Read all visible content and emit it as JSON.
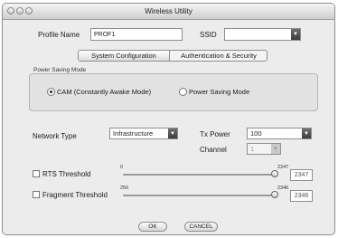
{
  "window": {
    "title": "Wireless Utility"
  },
  "profile": {
    "label": "Profile Name",
    "value": "PROF1"
  },
  "ssid": {
    "label": "SSID",
    "value": ""
  },
  "tabs": [
    {
      "label": "System Configuration",
      "active": true
    },
    {
      "label": "Authentication & Security",
      "active": false
    }
  ],
  "power_saving": {
    "group_label": "Power Saving Mode",
    "options": [
      {
        "label": "CAM (Constantly Awake Mode)",
        "selected": true
      },
      {
        "label": "Power Saving Mode",
        "selected": false
      }
    ]
  },
  "network_type": {
    "label": "Network Type",
    "value": "Infrastructure"
  },
  "tx_power": {
    "label": "Tx Power",
    "value": "100"
  },
  "channel": {
    "label": "Channel",
    "value": "1"
  },
  "rts": {
    "label": "RTS Threshold",
    "checked": false,
    "min": "0",
    "max": "2347",
    "value": "2347",
    "level": 1.0
  },
  "fragment": {
    "label": "Fragment Threshold",
    "checked": false,
    "min": "256",
    "max": "2346",
    "value": "2346",
    "level": 1.0
  },
  "buttons": {
    "ok": "OK",
    "cancel": "CANCEL"
  }
}
